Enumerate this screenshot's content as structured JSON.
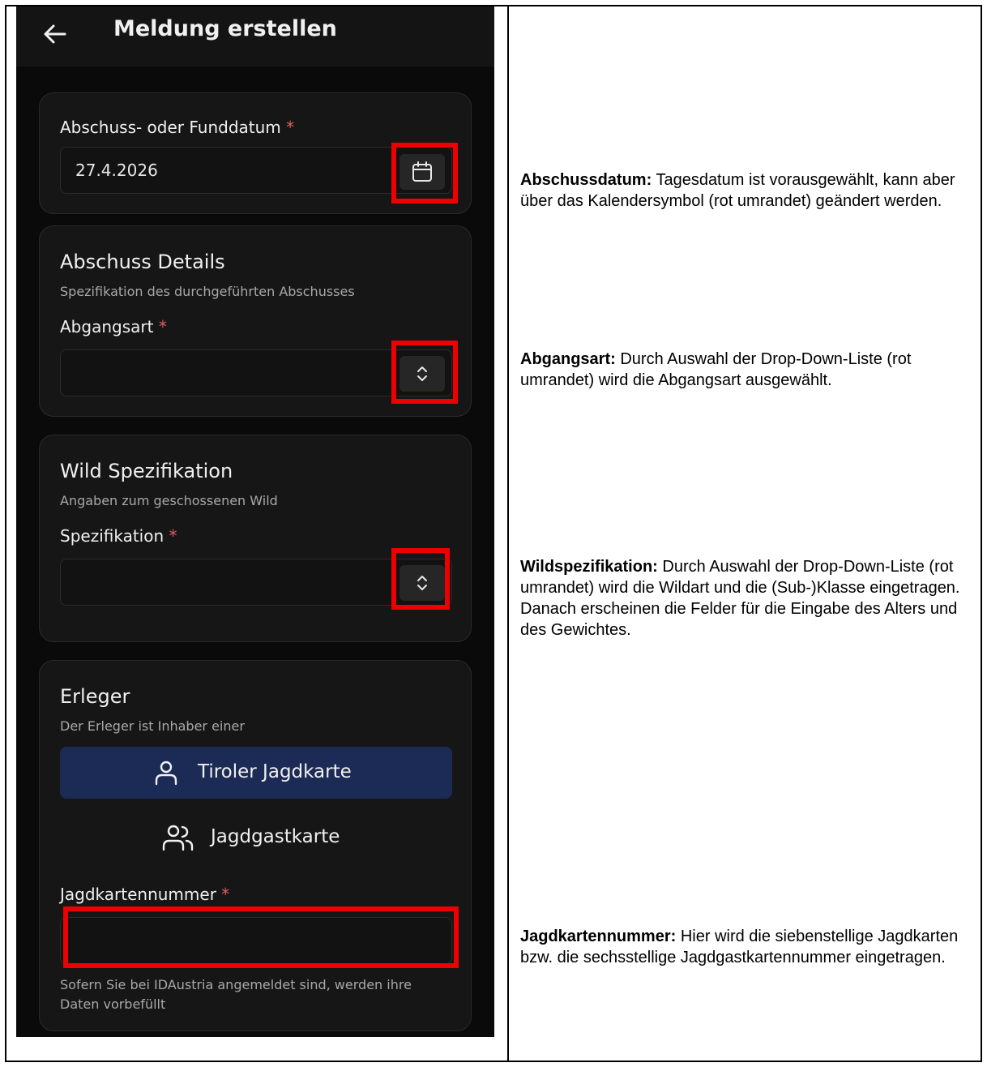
{
  "app": {
    "title": "Meldung erstellen"
  },
  "date_card": {
    "label": "Abschuss- oder Funddatum",
    "required_mark": "*",
    "value": "27.4.2026"
  },
  "details_card": {
    "title": "Abschuss Details",
    "subtitle": "Spezifikation des durchgeführten Abschusses",
    "field_label": "Abgangsart",
    "required_mark": "*",
    "value": ""
  },
  "wild_card": {
    "title": "Wild Spezifikation",
    "subtitle": "Angaben zum geschossenen Wild",
    "field_label": "Spezifikation",
    "required_mark": "*",
    "value": ""
  },
  "erleger_card": {
    "title": "Erleger",
    "subtitle": "Der Erleger ist Inhaber einer",
    "option_1": "Tiroler Jagdkarte",
    "option_2": "Jagdgastkarte",
    "field_label": "Jagdkartennummer",
    "required_mark": "*",
    "value": "",
    "helper": "Sofern Sie bei IDAustria angemeldet sind, werden ihre Daten vorbefüllt"
  },
  "notes": {
    "date_title": "Abschussdatum:",
    "date_text": " Tagesdatum ist vorausgewählt, kann aber über das Kalendersymbol (rot umrandet) geändert werden.",
    "abgang_title": "Abgangsart:",
    "abgang_text": " Durch Auswahl der Drop-Down-Liste (rot umrandet) wird die Abgangsart ausgewählt.",
    "wild_title": "Wildspezifikation:",
    "wild_text": " Durch Auswahl der Drop-Down-Liste (rot umrandet) wird die Wildart und die (Sub-)Klasse eingetragen. Danach erscheinen die Felder für die Eingabe des Alters und des Gewichtes.",
    "jagd_title": "Jagdkartennummer:",
    "jagd_text": " Hier wird die siebenstellige Jagdkarten bzw. die sechsstellige Jagdgastkartennummer eingetragen."
  },
  "colors": {
    "highlight": "#ee0000",
    "selected_option": "#1b2b55",
    "required": "#e35d5d"
  },
  "icons": [
    "arrow-left-icon",
    "calendar-icon",
    "chevron-up-down-icon",
    "user-icon",
    "users-icon"
  ]
}
